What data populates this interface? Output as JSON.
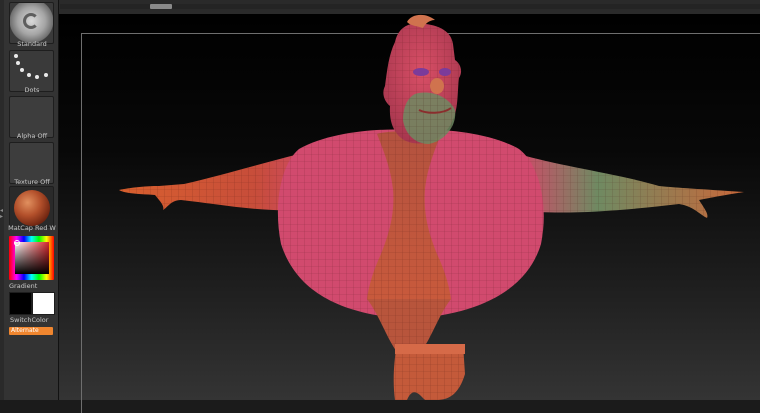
{
  "shelf": {
    "brush": {
      "label": "Standard",
      "icon": "standard-brush-icon"
    },
    "stroke": {
      "label": "Dots",
      "icon": "dots-stroke-icon"
    },
    "alpha": {
      "label": "Alpha Off"
    },
    "texture": {
      "label": "Texture Off"
    },
    "material": {
      "label": "MatCap Red W",
      "icon": "matcap-sphere-icon",
      "color": "#b3502b"
    },
    "gradient": {
      "label": "Gradient"
    },
    "switch_color": {
      "label": "SwitchColor",
      "primary": "#000000",
      "secondary": "#ffffff"
    },
    "alternate": {
      "label": "Alternate",
      "color": "#f0862f"
    }
  },
  "canvas": {
    "subject": "polygroup-character-model",
    "colors": {
      "skin": "#c9523a",
      "polygroup_pink": "#d14a6e",
      "polygroup_green": "#6f8a62"
    }
  }
}
